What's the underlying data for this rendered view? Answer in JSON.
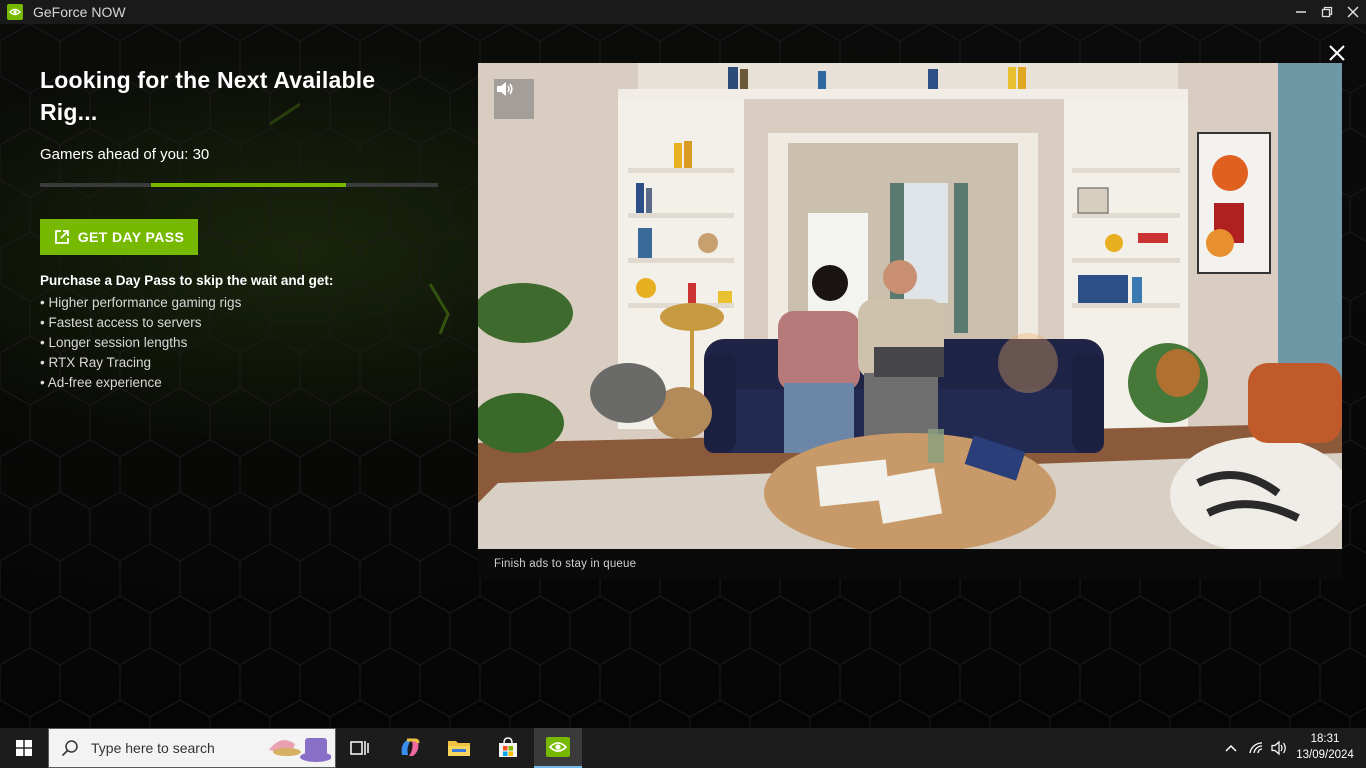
{
  "window": {
    "title": "GeForce NOW"
  },
  "queue": {
    "heading": "Looking for the Next Available Rig...",
    "gamers_ahead": "Gamers ahead of you: 30",
    "progress_start_fraction": 0.28,
    "progress_end_fraction": 0.77,
    "day_pass_button": "GET DAY PASS",
    "benefits_title": "Purchase a Day Pass to skip the wait and get:",
    "benefits": [
      "• Higher performance gaming rigs",
      "• Fastest access to servers",
      "• Longer session lengths",
      "• RTX Ray Tracing",
      "• Ad-free experience"
    ]
  },
  "video": {
    "caption": "Finish ads to stay in queue"
  },
  "taskbar": {
    "search_placeholder": "Type here to search",
    "time": "18:31",
    "date": "13/09/2024"
  },
  "colors": {
    "accent": "#76b900",
    "background": "#000000"
  }
}
